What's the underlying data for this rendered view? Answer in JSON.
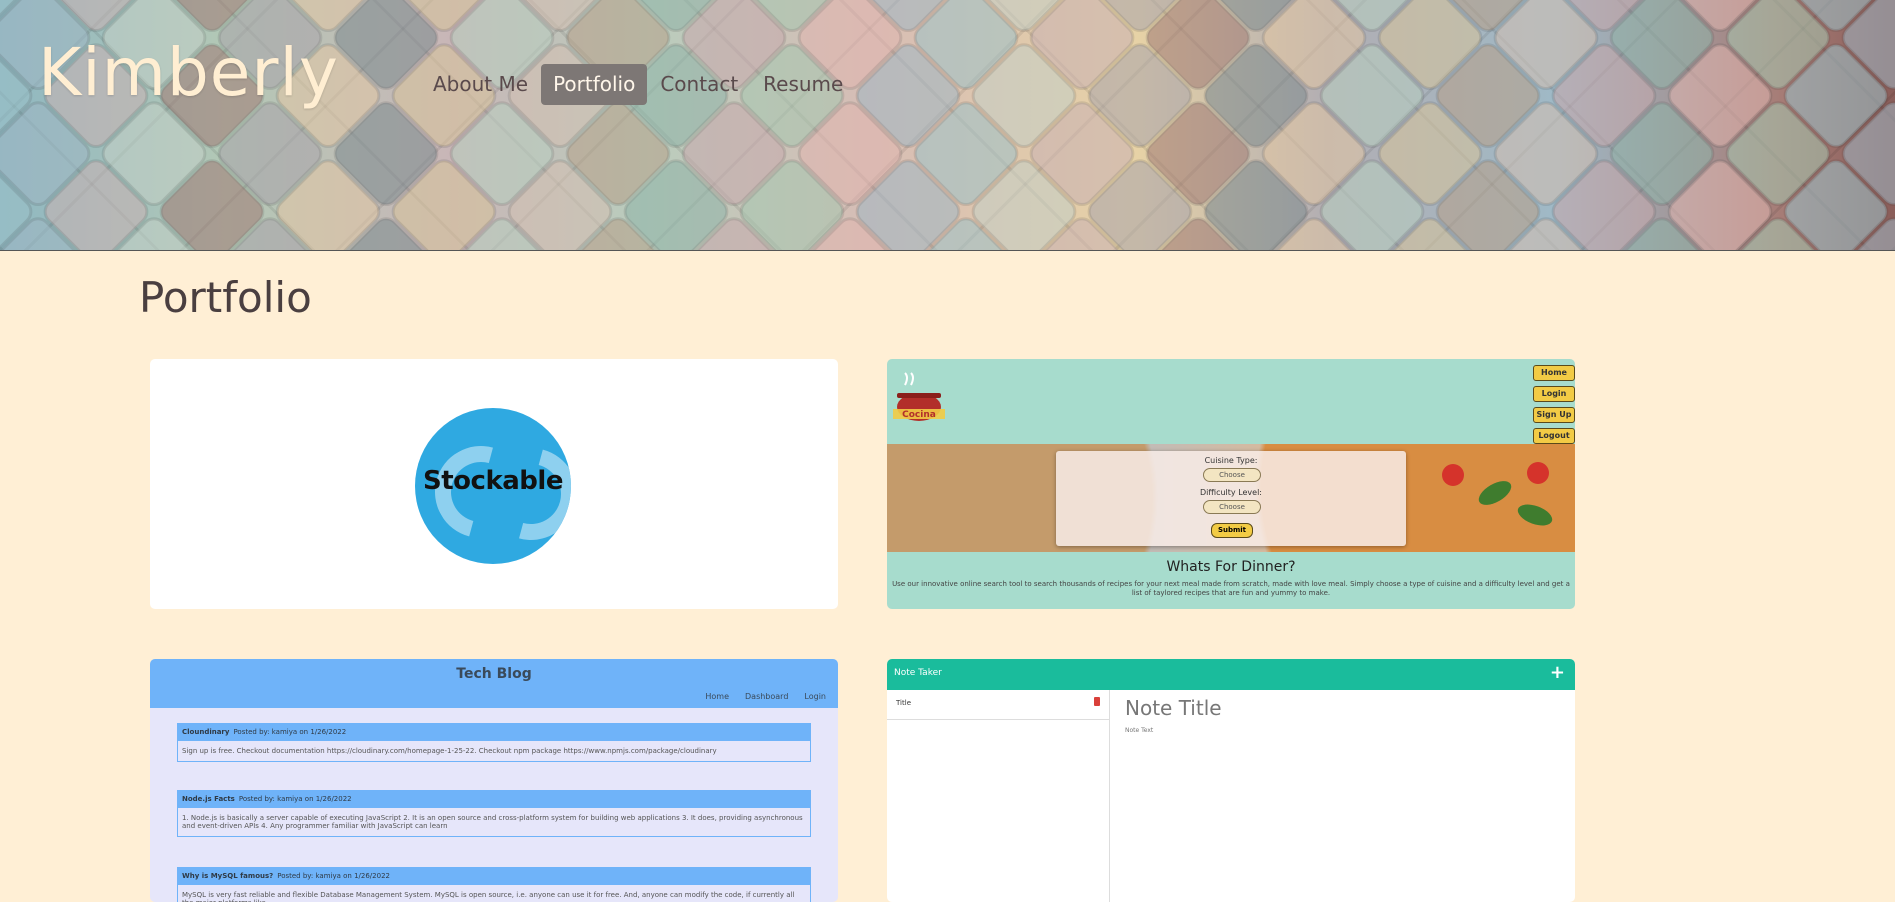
{
  "header": {
    "brand": "Kimberly",
    "nav": [
      {
        "label": "About Me",
        "active": false
      },
      {
        "label": "Portfolio",
        "active": true
      },
      {
        "label": "Contact",
        "active": false
      },
      {
        "label": "Resume",
        "active": false
      }
    ]
  },
  "portfolio": {
    "heading": "Portfolio",
    "projects": [
      {
        "name": "Stockable",
        "logo_text": "Stockable"
      },
      {
        "name": "Cocina",
        "logo_text": "Cocina",
        "buttons": [
          "Home",
          "Login",
          "Sign Up",
          "Logout"
        ],
        "form": {
          "cuisine_label": "Cuisine Type:",
          "cuisine_value": "Choose",
          "difficulty_label": "Difficulty Level:",
          "difficulty_value": "Choose",
          "submit": "Submit"
        },
        "title": "Whats For Dinner?",
        "description": "Use our innovative online search tool to search thousands of recipes for your next meal made from scratch, made with love meal. Simply choose a type of cuisine and a difficulty level and get a list of taylored recipes that are fun and yummy to make."
      },
      {
        "name": "Tech Blog",
        "title": "Tech Blog",
        "nav": [
          "Home",
          "Dashboard",
          "Login"
        ],
        "posts": [
          {
            "title": "Cloundinary",
            "meta": "Posted by: kamiya on 1/26/2022",
            "body": "Sign up is free. Checkout documentation https://cloudinary.com/homepage-1-25-22. Checkout npm package https://www.npmjs.com/package/cloudinary"
          },
          {
            "title": "Node.js Facts",
            "meta": "Posted by: kamiya on 1/26/2022",
            "body": "1. Node.js is basically a server capable of executing JavaScript 2. It is an open source and cross-platform system for building web applications 3. It does, providing asynchronous and event-driven APIs 4. Any programmer familiar with JavaScript can learn"
          },
          {
            "title": "Why is MySQL famous?",
            "meta": "Posted by: kamiya on 1/26/2022",
            "body": "MySQL is very fast reliable and flexible Database Management System. MySQL is open source, i.e. anyone can use it for free. And, anyone can modify the code, if currently all the major platforms like"
          }
        ]
      },
      {
        "name": "Note Taker",
        "brand": "Note Taker",
        "add_icon": "+",
        "list_item": "Title",
        "note_title": "Note Title",
        "note_text": "Note Text"
      }
    ]
  },
  "colors": {
    "page_bg": "#ffefd5",
    "brand_text": "#ffeed2",
    "nav_active_bg": "#7d7775",
    "cocina_bg": "#a7dccd",
    "techblog_accent": "#6fb3f9",
    "notetaker_accent": "#1abc9c"
  }
}
